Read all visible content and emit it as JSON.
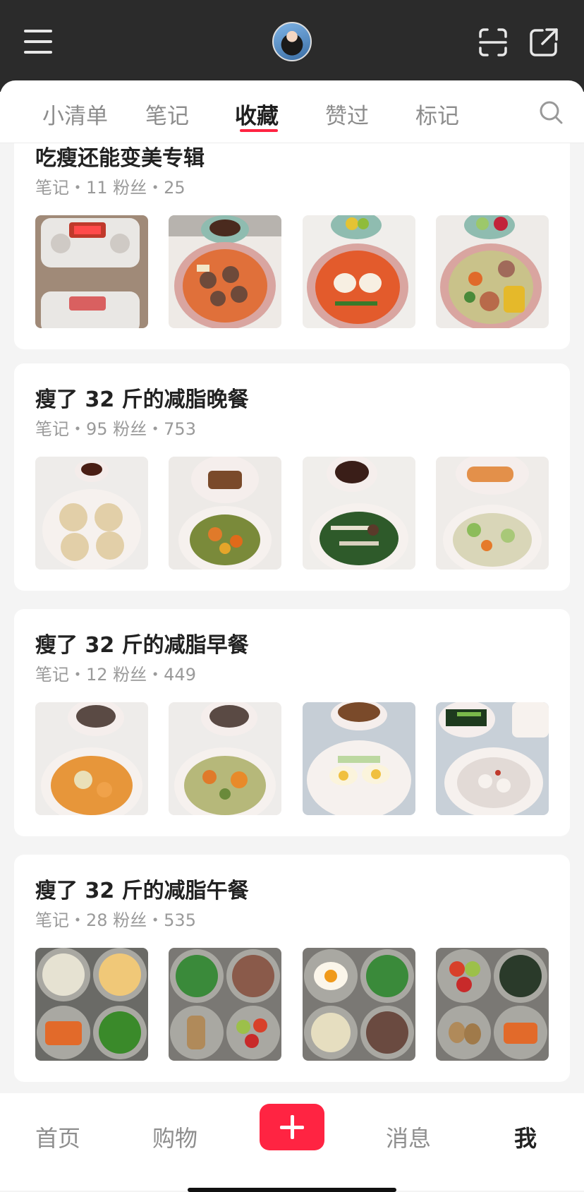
{
  "header": {
    "menu_icon": "menu-icon",
    "avatar": "avatar",
    "scan_icon": "scan-icon",
    "share_icon": "share-icon"
  },
  "tabs": [
    {
      "label": "小清单"
    },
    {
      "label": "笔记"
    },
    {
      "label": "收藏"
    },
    {
      "label": "赞过"
    },
    {
      "label": "标记"
    }
  ],
  "active_tab": "收藏",
  "collections": [
    {
      "title": "吃瘦还能变美专辑",
      "meta": "笔记・11  粉丝・25",
      "thumbs": [
        "scale-photo",
        "meatball-soup",
        "egg-tomato-soup",
        "corn-veggie-soup"
      ]
    },
    {
      "title": "瘦了 32 斤的减脂晚餐",
      "meta": "笔记・95  粉丝・753",
      "thumbs": [
        "dumplings",
        "pumpkin-stew",
        "mushroom-greens",
        "cabbage-soup"
      ]
    },
    {
      "title": "瘦了 32 斤的减脂早餐",
      "meta": "笔记・12  粉丝・449",
      "thumbs": [
        "veggie-soup",
        "meatball-veg-soup",
        "egg-noodle-soup",
        "rice-porridge"
      ]
    },
    {
      "title": "瘦了 32 斤的减脂午餐",
      "meta": "笔记・28  粉丝・535",
      "thumbs": [
        "bento-sweet-potato",
        "bento-beans-beef",
        "bento-egg-greens",
        "bento-tomato-egg"
      ]
    }
  ],
  "bottom_nav": [
    {
      "label": "首页"
    },
    {
      "label": "购物"
    },
    {
      "label": "消息"
    },
    {
      "label": "我"
    }
  ],
  "colors": {
    "accent": "#ff2442",
    "header_bg": "#2b2b2b"
  }
}
